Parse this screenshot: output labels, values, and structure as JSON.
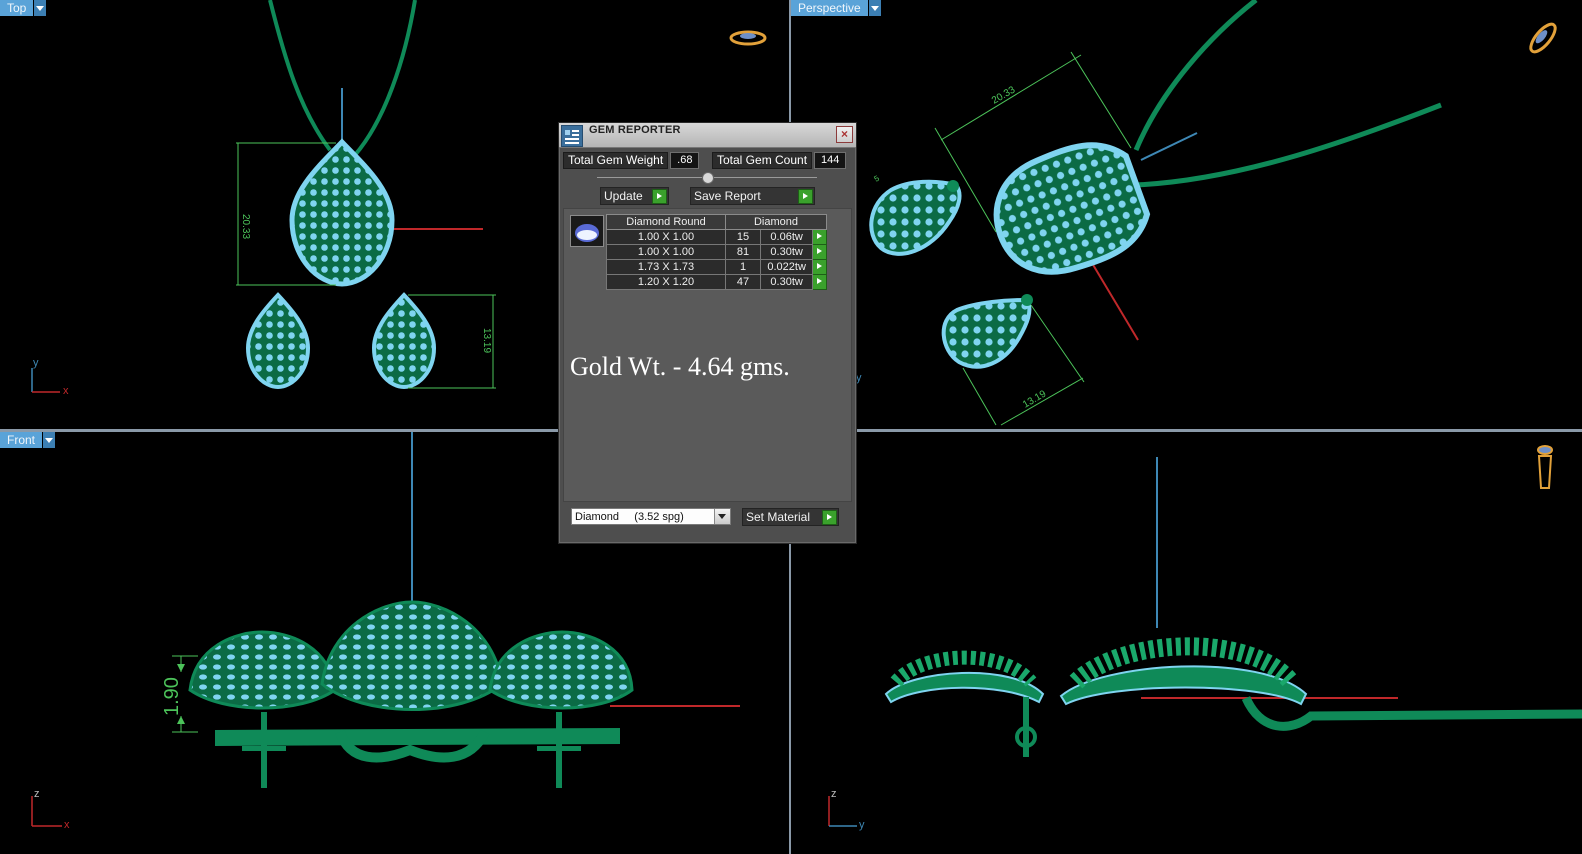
{
  "viewports": {
    "top": {
      "label": "Top"
    },
    "perspective": {
      "label": "Perspective"
    },
    "front": {
      "label": "Front"
    }
  },
  "dimensions": {
    "top_length": "20.33",
    "top_earring": "13.19",
    "persp_length": "20.33",
    "persp_earring": "13.19",
    "front_height": "1.90"
  },
  "axes": {
    "x": "x",
    "y": "y",
    "z": "z"
  },
  "gem_reporter": {
    "title": "GEM REPORTER",
    "total_weight_label": "Total Gem Weight",
    "total_weight_value": ".68",
    "total_count_label": "Total Gem Count",
    "total_count_value": "144",
    "update_label": "Update",
    "save_label": "Save Report",
    "table": {
      "headers": [
        "Diamond Round",
        "Diamond"
      ],
      "rows": [
        {
          "size": "1.00 X 1.00",
          "count": "15",
          "weight": "0.06tw"
        },
        {
          "size": "1.00 X 1.00",
          "count": "81",
          "weight": "0.30tw"
        },
        {
          "size": "1.73 X 1.73",
          "count": "1",
          "weight": "0.022tw"
        },
        {
          "size": "1.20 X 1.20",
          "count": "47",
          "weight": "0.30tw"
        }
      ]
    },
    "gold_weight": "Gold Wt. - 4.64 gms.",
    "material_select": "Diamond     (3.52 spg)",
    "set_material_label": "Set Material"
  },
  "colors": {
    "metal": "#0c7a4e",
    "gem": "#7fd4f0",
    "dimension": "#4cc35a",
    "axis_x": "#c0282a",
    "axis_z": "#3e88b5"
  }
}
